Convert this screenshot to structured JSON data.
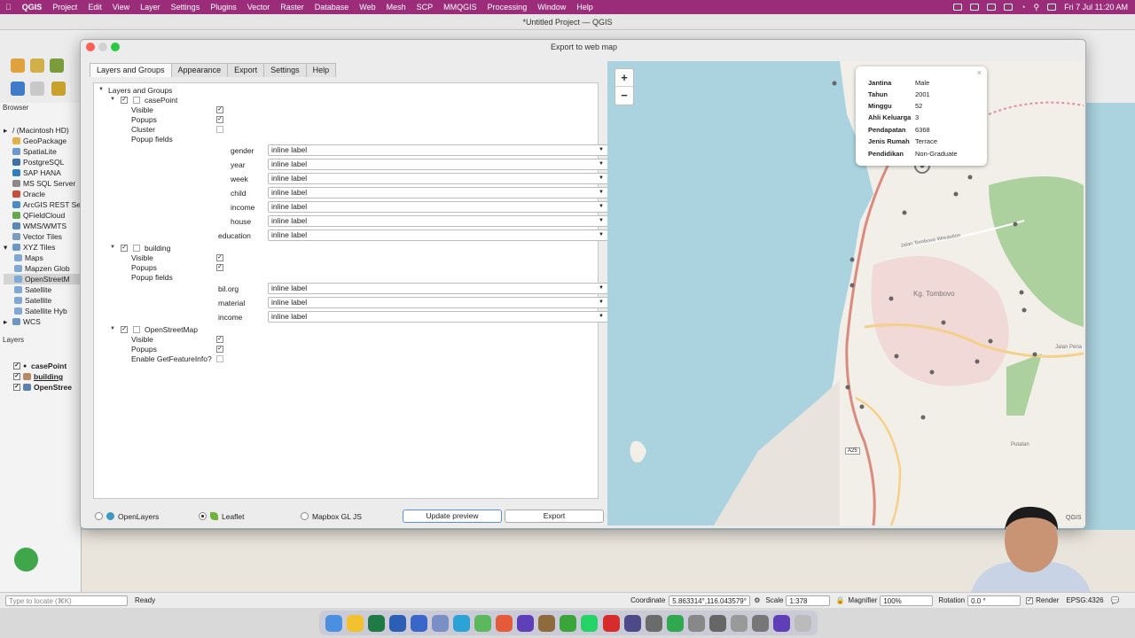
{
  "menubar": {
    "app": "QGIS",
    "items": [
      "Project",
      "Edit",
      "View",
      "Layer",
      "Settings",
      "Plugins",
      "Vector",
      "Raster",
      "Database",
      "Web",
      "Mesh",
      "SCP",
      "MMQGIS",
      "Processing",
      "Window",
      "Help"
    ],
    "clock": "Fri 7 Jul  11:20 AM"
  },
  "window_title": "*Untitled Project — QGIS",
  "browser": {
    "title": "Browser",
    "items": [
      "/ (Macintosh HD)",
      "GeoPackage",
      "SpatiaLite",
      "PostgreSQL",
      "SAP HANA",
      "MS SQL Server",
      "Oracle",
      "ArcGIS REST Se",
      "QFieldCloud",
      "WMS/WMTS",
      "Vector Tiles",
      "XYZ Tiles",
      "Maps",
      "Mapzen Glob",
      "OpenStreetM",
      "Satellite",
      "Satellite",
      "Satellite Hyb",
      "WCS"
    ]
  },
  "layers": {
    "title": "Layers",
    "items": [
      "casePoint",
      "building",
      "OpenStree"
    ]
  },
  "dialog": {
    "title": "Export to web map",
    "tabs": [
      "Layers and Groups",
      "Appearance",
      "Export",
      "Settings",
      "Help"
    ],
    "root": "Layers and Groups",
    "layer_casepoint": "casePoint",
    "layer_building": "building",
    "layer_osm": "OpenStreetMap",
    "visible": "Visible",
    "popups": "Popups",
    "cluster": "Cluster",
    "popup_fields": "Popup fields",
    "enable_gfi": "Enable GetFeatureInfo?",
    "field_value": "inline label",
    "casepoint_fields": [
      "gender",
      "year",
      "week",
      "child",
      "income",
      "house",
      "education"
    ],
    "building_fields": [
      "bil.org",
      "material",
      "income"
    ],
    "radio_openlayers": "OpenLayers",
    "radio_leaflet": "Leaflet",
    "radio_mapbox": "Mapbox GL JS",
    "update_preview": "Update preview",
    "export": "Export"
  },
  "preview": {
    "zoom_in": "+",
    "zoom_out": "−",
    "popup_close": "×",
    "popup": [
      {
        "k": "Jantina",
        "v": "Male"
      },
      {
        "k": "Tahun",
        "v": "2001"
      },
      {
        "k": "Minggu",
        "v": "52"
      },
      {
        "k": "Ahli Keluarga",
        "v": "3"
      },
      {
        "k": "Pendapatan",
        "v": "6368"
      },
      {
        "k": "Jenis Rumah",
        "v": "Terrace"
      },
      {
        "k": "Pendidikan",
        "v": "Non-Graduate"
      }
    ],
    "labels": {
      "town": "Kg. Tombovo",
      "road1": "Jalan Tombovo Wreastion",
      "road2": "Jalan Pena",
      "a25": "A25",
      "putatan": "Putatan",
      "qgis": "QGIS"
    }
  },
  "statusbar": {
    "locate_placeholder": "Type to locate (⌘K)",
    "ready": "Ready",
    "coordinate_label": "Coordinate",
    "coordinate": "5.863314°,116.043579°",
    "scale_label": "Scale",
    "scale": "1:378",
    "magnifier_label": "Magnifier",
    "magnifier": "100%",
    "rotation_label": "Rotation",
    "rotation": "0.0 °",
    "render": "Render",
    "crs": "EPSG:4326"
  },
  "colors": {
    "menubar": "#9b2c7a",
    "water": "#aad3df",
    "land": "#f2efe9",
    "urban": "#f0d9d6",
    "park": "#add19e"
  }
}
